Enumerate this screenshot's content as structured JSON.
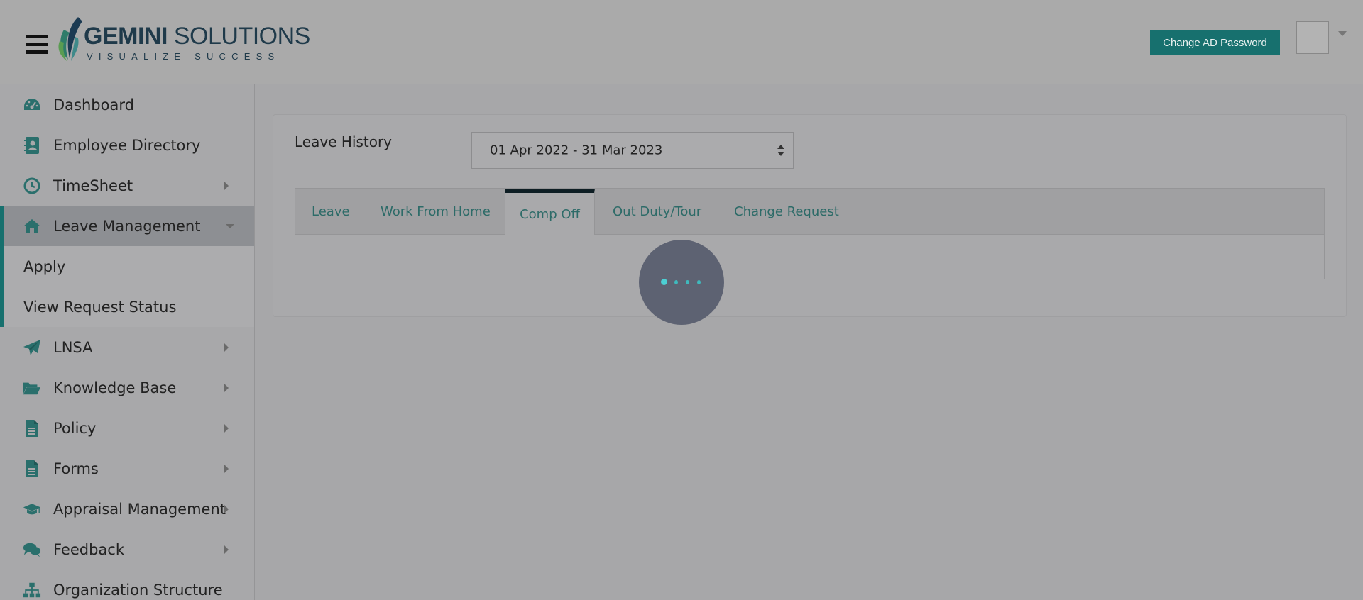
{
  "header": {
    "logo_name_bold": "GEMINI",
    "logo_name_light": "SOLUTIONS",
    "logo_tagline": "VISUALIZE SUCCESS",
    "change_password_label": "Change AD Password"
  },
  "colors": {
    "accent": "#17706e",
    "tab_text": "#2d6b68",
    "loader_dot": "#4ccfd3"
  },
  "sidebar": {
    "items": [
      {
        "label": "Dashboard",
        "icon": "dashboard-icon",
        "has_arrow": false
      },
      {
        "label": "Employee Directory",
        "icon": "address-book-icon",
        "has_arrow": false
      },
      {
        "label": "TimeSheet",
        "icon": "clock-icon",
        "has_arrow": true
      },
      {
        "label": "Leave Management",
        "icon": "home-icon",
        "active": true,
        "expanded": true
      },
      {
        "label": "LNSA",
        "icon": "paper-plane-icon",
        "has_arrow": true
      },
      {
        "label": "Knowledge Base",
        "icon": "folder-open-icon",
        "has_arrow": true
      },
      {
        "label": "Policy",
        "icon": "document-icon",
        "has_arrow": true
      },
      {
        "label": "Forms",
        "icon": "document-icon",
        "has_arrow": true
      },
      {
        "label": "Appraisal Management",
        "icon": "graduation-cap-icon",
        "has_arrow": true
      },
      {
        "label": "Feedback",
        "icon": "comments-icon",
        "has_arrow": true
      },
      {
        "label": "Organization Structure",
        "icon": "sitemap-icon",
        "has_arrow": false
      }
    ],
    "sub_items": [
      "Apply",
      "View Request Status"
    ]
  },
  "main": {
    "title": "Leave History",
    "period_select": "01 Apr 2022 - 31 Mar 2023",
    "tabs": [
      {
        "label": "Leave"
      },
      {
        "label": "Work From Home"
      },
      {
        "label": "Comp Off",
        "active": true
      },
      {
        "label": "Out Duty/Tour"
      },
      {
        "label": "Change Request"
      }
    ]
  }
}
